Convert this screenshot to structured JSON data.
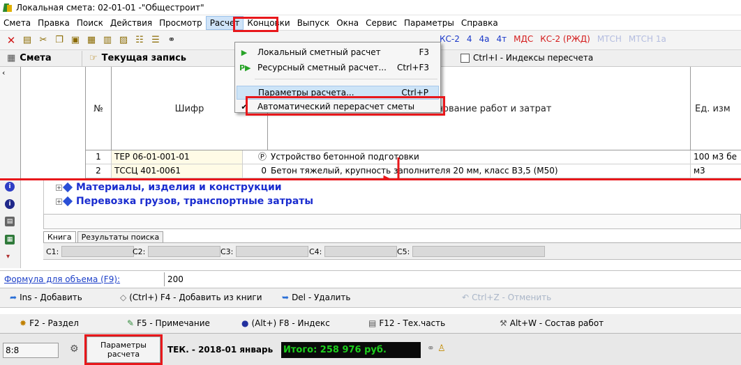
{
  "window": {
    "title": "Локальная смета: 02-01-01 -\"Общестроит\""
  },
  "menubar": [
    {
      "label": "Смета",
      "active": false
    },
    {
      "label": "Правка",
      "active": false
    },
    {
      "label": "Поиск",
      "active": false
    },
    {
      "label": "Действия",
      "active": false
    },
    {
      "label": "Просмотр",
      "active": false
    },
    {
      "label": "Расчет",
      "active": true
    },
    {
      "label": "Концовки",
      "active": false
    },
    {
      "label": "Выпуск",
      "active": false
    },
    {
      "label": "Окна",
      "active": false
    },
    {
      "label": "Сервис",
      "active": false
    },
    {
      "label": "Параметры",
      "active": false
    },
    {
      "label": "Справка",
      "active": false
    }
  ],
  "toolbar": {
    "right_items": [
      {
        "label": "КС-2",
        "color": "#1a38c9"
      },
      {
        "label": "4",
        "color": "#1a38c9"
      },
      {
        "label": "4а",
        "color": "#1a38c9"
      },
      {
        "label": "4т",
        "color": "#1a38c9"
      },
      {
        "label": "МДС",
        "color": "#d41b1b"
      },
      {
        "label": "КС-2 (РЖД)",
        "color": "#d41b1b"
      },
      {
        "label": "МТСН",
        "color": "#b4bde0"
      },
      {
        "label": "МТСН 1а",
        "color": "#b4bde0"
      }
    ]
  },
  "tabs": {
    "smeta": "Смета",
    "current": "Текущая запись",
    "indices": "Ctrl+I - Индексы пересчета"
  },
  "grid": {
    "headers": {
      "num": "№",
      "code": "Шифр",
      "name": "Наименование работ и затрат",
      "unit": "Ед. изм"
    },
    "rows": [
      {
        "num": "1",
        "code": "ТЕР 06-01-001-01",
        "mark": "Ⓟ",
        "name": "Устройство бетонной подготовки",
        "unit": "100 м3 бе"
      },
      {
        "num": "2",
        "code": "ТССЦ 401-0061",
        "mark": "0",
        "name": "Бетон тяжелый, крупность заполнителя 20 мм, класс В3,5 (М50)",
        "unit": "м3"
      }
    ]
  },
  "tree": [
    "Материалы, изделия и конструкции",
    "Перевозка грузов, транспортные затраты"
  ],
  "subtabs": {
    "book": "Книга",
    "search": "Результаты поиска"
  },
  "c_fields": {
    "c1": "C1:",
    "c2": "C2:",
    "c3": "C3:",
    "c4": "C4:",
    "c5": "C5:"
  },
  "formula": {
    "label": "Формула для объема (F9):",
    "value": "200"
  },
  "actions": {
    "add": "Ins - Добавить",
    "add_from_book": "(Ctrl+) F4 - Добавить из книги",
    "delete": "Del - Удалить",
    "undo": "Ctrl+Z - Отменить",
    "section": "F2 - Раздел",
    "note": "F5 - Примечание",
    "index": "(Alt+) F8 - Индекс",
    "techpart": "F12 - Тех.часть",
    "works": "Alt+W - Состав работ"
  },
  "status": {
    "position": "8:8",
    "params_button": "Параметры расчета",
    "period": "ТЕК. - 2018-01 январь",
    "total": "Итого: 258 976 руб."
  },
  "dropdown": {
    "items": [
      {
        "label": "Локальный сметный расчет",
        "shortcut": "F3"
      },
      {
        "label": "Ресурсный сметный расчет...",
        "shortcut": "Ctrl+F3"
      },
      {
        "label": "Параметры расчета...",
        "shortcut": "Ctrl+P"
      },
      {
        "label": "Автоматический перерасчет сметы",
        "shortcut": ""
      }
    ]
  }
}
